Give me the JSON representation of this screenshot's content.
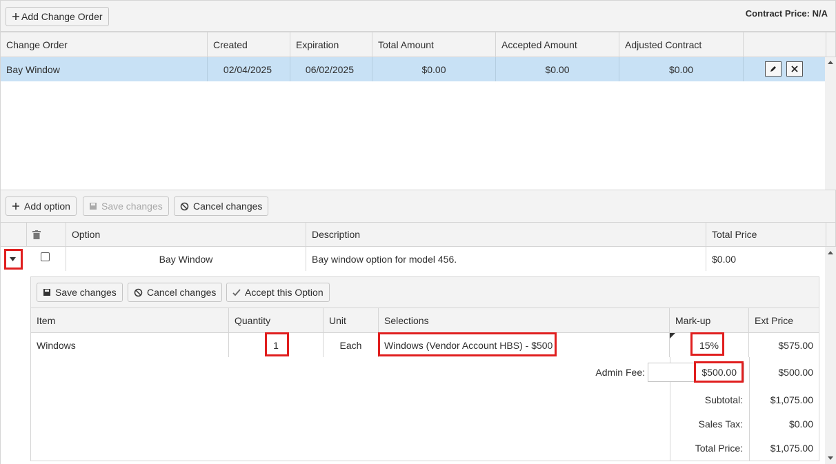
{
  "toolbar": {
    "add_change_order": "Add Change Order",
    "contract_price": "Contract Price: N/A"
  },
  "co_grid": {
    "columns": [
      "Change Order",
      "Created",
      "Expiration",
      "Total Amount",
      "Accepted Amount",
      "Adjusted Contract"
    ],
    "rows": [
      {
        "name": "Bay Window",
        "created": "02/04/2025",
        "expiration": "06/02/2025",
        "total": "$0.00",
        "accepted": "$0.00",
        "adjusted": "$0.00"
      }
    ]
  },
  "option_toolbar": {
    "add": "Add option",
    "save": "Save changes",
    "cancel": "Cancel changes"
  },
  "option_grid": {
    "columns": [
      "Option",
      "Description",
      "Total Price"
    ],
    "rows": [
      {
        "option": "Bay Window",
        "description": "Bay window option for model 456.",
        "total": "$0.00"
      }
    ]
  },
  "detail_toolbar": {
    "save": "Save changes",
    "cancel": "Cancel changes",
    "accept": "Accept this Option"
  },
  "item_grid": {
    "columns": [
      "Item",
      "Quantity",
      "Unit",
      "Selections",
      "Mark-up",
      "Ext Price"
    ],
    "rows": [
      {
        "item": "Windows",
        "quantity": "1",
        "unit": "Each",
        "selection": "Windows (Vendor Account HBS) - $500",
        "markup": "15%",
        "ext": "$575.00"
      }
    ]
  },
  "summary": {
    "admin_fee_label": "Admin Fee:",
    "admin_fee_value": "$500.00",
    "admin_fee_ext": "$500.00",
    "subtotal_label": "Subtotal:",
    "subtotal": "$1,075.00",
    "tax_label": "Sales Tax:",
    "tax": "$0.00",
    "total_label": "Total Price:",
    "total": "$1,075.00"
  },
  "colors": {
    "highlight": "#e01e1e",
    "selected_row": "#c8e1f5"
  }
}
